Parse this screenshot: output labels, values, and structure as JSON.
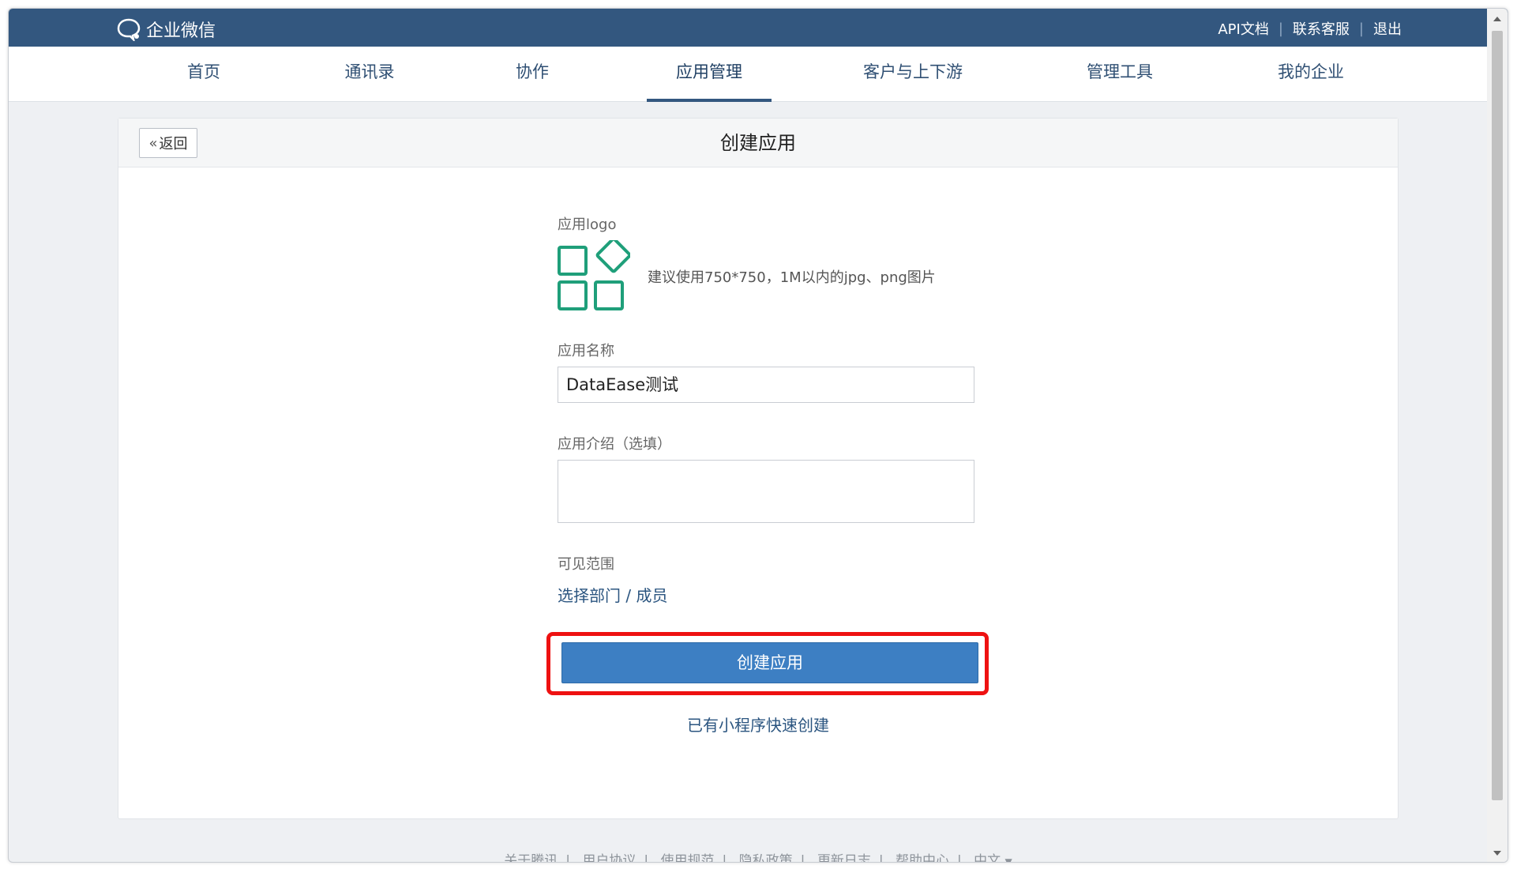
{
  "brand": {
    "name": "企业微信"
  },
  "top_links": [
    "API文档",
    "联系客服",
    "退出"
  ],
  "nav": {
    "items": [
      {
        "label": "首页"
      },
      {
        "label": "通讯录"
      },
      {
        "label": "协作"
      },
      {
        "label": "应用管理",
        "active": true
      },
      {
        "label": "客户与上下游"
      },
      {
        "label": "管理工具"
      },
      {
        "label": "我的企业"
      }
    ]
  },
  "page": {
    "back_label": "返回",
    "title": "创建应用"
  },
  "form": {
    "logo_label": "应用logo",
    "logo_hint": "建议使用750*750，1M以内的jpg、png图片",
    "name_label": "应用名称",
    "name_value": "DataEase测试",
    "intro_label": "应用介绍（选填）",
    "intro_value": "",
    "scope_label": "可见范围",
    "scope_link": "选择部门 / 成员",
    "submit_label": "创建应用",
    "quick_create_link": "已有小程序快速创建"
  },
  "footer": {
    "links": [
      "关于腾讯",
      "用户协议",
      "使用规范",
      "隐私政策",
      "更新日志",
      "帮助中心"
    ],
    "language": "中文",
    "language_icon": "caret-down-icon"
  },
  "colors": {
    "header_bg": "#33577f",
    "primary_button": "#3d7fc3",
    "highlight_box": "#ee1111",
    "logo_green": "#1f9f7a"
  }
}
